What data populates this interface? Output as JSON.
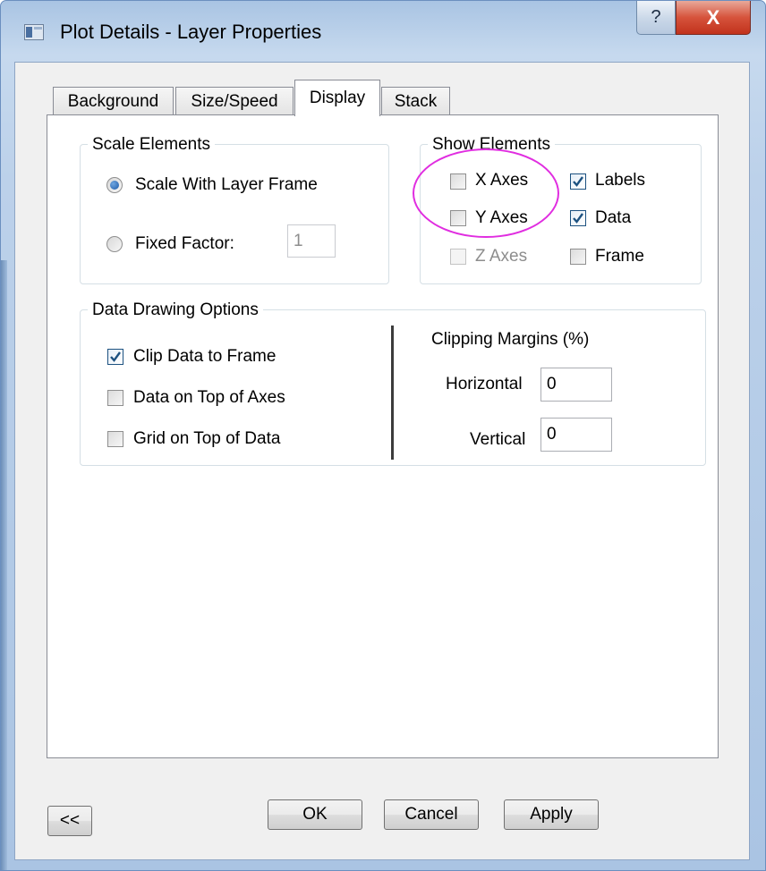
{
  "window": {
    "title": "Plot Details - Layer Properties",
    "help_label": "?",
    "close_label": "X"
  },
  "tabs": [
    {
      "label": "Background"
    },
    {
      "label": "Size/Speed"
    },
    {
      "label": "Display",
      "active": true
    },
    {
      "label": "Stack"
    }
  ],
  "scale_elements": {
    "legend": "Scale Elements",
    "option_frame": "Scale With Layer Frame",
    "option_fixed": "Fixed Factor:",
    "selected": "option_frame",
    "factor_value": "1"
  },
  "show_elements": {
    "legend": "Show Elements",
    "items": [
      {
        "label": "X Axes",
        "checked": false,
        "enabled": true
      },
      {
        "label": "Y Axes",
        "checked": false,
        "enabled": true
      },
      {
        "label": "Z Axes",
        "checked": false,
        "enabled": false
      },
      {
        "label": "Labels",
        "checked": true,
        "enabled": true
      },
      {
        "label": "Data",
        "checked": true,
        "enabled": true
      },
      {
        "label": "Frame",
        "checked": false,
        "enabled": true
      }
    ]
  },
  "data_drawing": {
    "legend": "Data Drawing Options",
    "items": [
      {
        "label": "Clip Data to Frame",
        "checked": true
      },
      {
        "label": "Data on Top of Axes",
        "checked": false
      },
      {
        "label": "Grid on Top of Data",
        "checked": false
      }
    ],
    "clipping_title": "Clipping Margins (%)",
    "horizontal_label": "Horizontal",
    "horizontal_value": "0",
    "vertical_label": "Vertical",
    "vertical_value": "0"
  },
  "buttons": {
    "collapse": "<<",
    "ok": "OK",
    "cancel": "Cancel",
    "apply": "Apply"
  },
  "colors": {
    "highlight_ellipse": "#e02de0",
    "checkmark": "#1c5180"
  }
}
